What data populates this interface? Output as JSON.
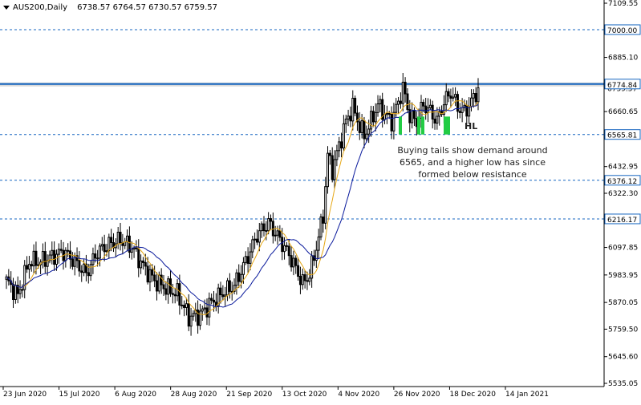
{
  "header": {
    "symbol": "AUS200,Daily",
    "ohlc": "6738.57 6764.57 6730.57 6759.57"
  },
  "annotation": {
    "text": "Buying tails show demand around 6565, and a higher low has since formed below resistance",
    "hl": "HL"
  },
  "colors": {
    "up": "#000000",
    "down": "#000000",
    "fast_ma": "#e6a817",
    "slow_ma": "#0a1a9c",
    "resistance": "#1565c0",
    "dashed": "#1565c0",
    "tail_highlight": "#22cc44"
  },
  "chart_data": {
    "type": "candlestick",
    "symbol": "AUS200",
    "timeframe": "Daily",
    "y_ticks": [
      7109.55,
      6885.1,
      6660.65,
      6432.95,
      6322.3,
      6097.85,
      5983.95,
      5870.05,
      5759.5,
      5645.6,
      5535.05
    ],
    "ylim": [
      5535.05,
      7109.55
    ],
    "x_labels": [
      "23 Jun 2020",
      "15 Jul 2020",
      "6 Aug 2020",
      "28 Aug 2020",
      "21 Sep 2020",
      "13 Oct 2020",
      "4 Nov 2020",
      "26 Nov 2020",
      "18 Dec 2020",
      "14 Jan 2021"
    ],
    "current_price": 6759.57,
    "levels": [
      {
        "value": 7000.0,
        "label": "7000.00",
        "style": "dashed"
      },
      {
        "value": 6774.84,
        "label": "6774.84",
        "style": "solid"
      },
      {
        "value": 6565.81,
        "label": "6565.81",
        "style": "dashed"
      },
      {
        "value": 6376.12,
        "label": "6376.12",
        "style": "dashed"
      },
      {
        "value": 6216.17,
        "label": "6216.17",
        "style": "dashed"
      }
    ],
    "close_anchors": [
      [
        0,
        5960
      ],
      [
        5,
        5900
      ],
      [
        10,
        6040
      ],
      [
        15,
        6040
      ],
      [
        20,
        6060
      ],
      [
        25,
        6080
      ],
      [
        30,
        6040
      ],
      [
        35,
        5990
      ],
      [
        40,
        6080
      ],
      [
        45,
        6110
      ],
      [
        50,
        6130
      ],
      [
        55,
        6100
      ],
      [
        60,
        6020
      ],
      [
        65,
        5960
      ],
      [
        70,
        5930
      ],
      [
        75,
        5905
      ],
      [
        80,
        5810
      ],
      [
        85,
        5820
      ],
      [
        90,
        5870
      ],
      [
        95,
        5910
      ],
      [
        100,
        5940
      ],
      [
        105,
        6040
      ],
      [
        110,
        6150
      ],
      [
        115,
        6200
      ],
      [
        120,
        6130
      ],
      [
        125,
        6050
      ],
      [
        130,
        5950
      ],
      [
        133,
        5985
      ],
      [
        136,
        6100
      ],
      [
        139,
        6230
      ],
      [
        141,
        6480
      ],
      [
        143,
        6420
      ],
      [
        146,
        6520
      ],
      [
        149,
        6620
      ],
      [
        152,
        6680
      ],
      [
        155,
        6600
      ],
      [
        157,
        6560
      ],
      [
        160,
        6620
      ],
      [
        163,
        6690
      ],
      [
        166,
        6650
      ],
      [
        169,
        6620
      ],
      [
        172,
        6700
      ],
      [
        174,
        6760
      ],
      [
        177,
        6640
      ],
      [
        180,
        6620
      ],
      [
        183,
        6690
      ],
      [
        186,
        6660
      ],
      [
        189,
        6620
      ],
      [
        192,
        6700
      ],
      [
        195,
        6740
      ],
      [
        198,
        6680
      ],
      [
        201,
        6660
      ],
      [
        204,
        6700
      ],
      [
        207,
        6759.57
      ]
    ]
  }
}
